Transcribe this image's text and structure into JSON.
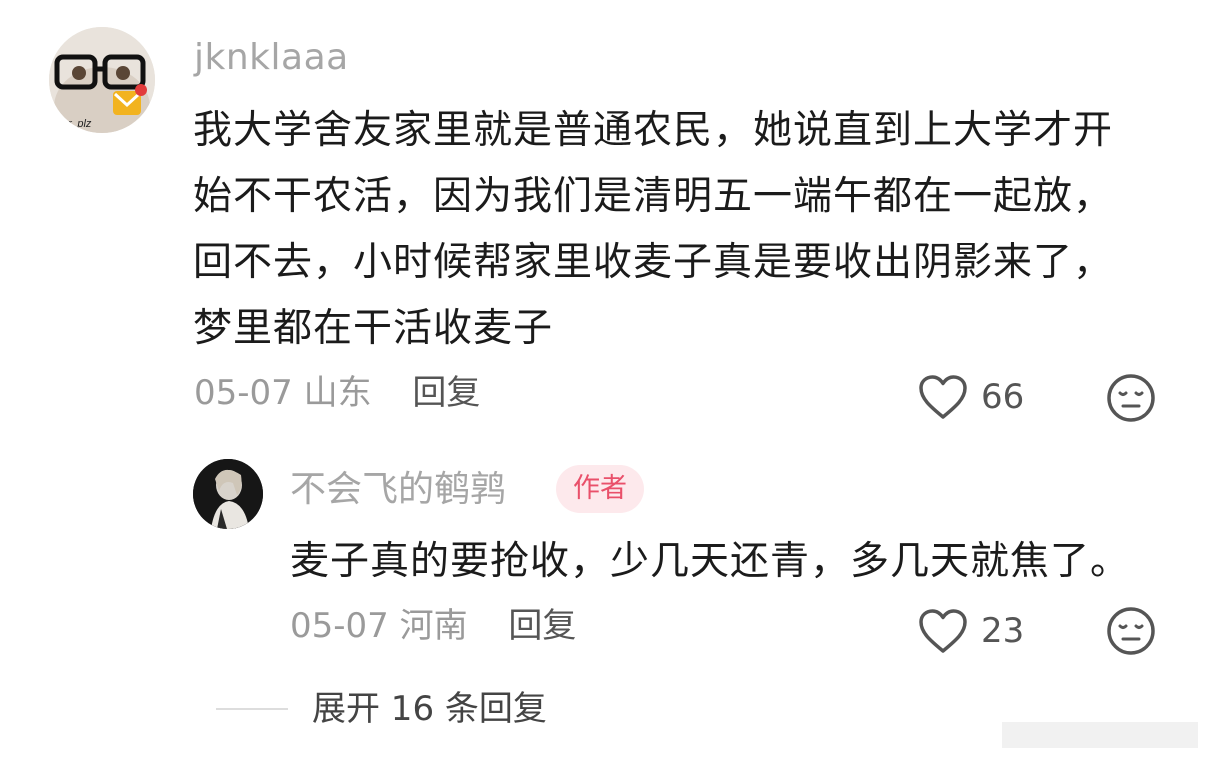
{
  "comment": {
    "username": "jknklaaa",
    "avatar": "glasses-dog-avatar",
    "avatar_caption": "fer, plz",
    "text": "我大学舍友家里就是普通农民，她说直到上大学才开\n始不干农活，因为我们是清明五一端午都在一起放，\n回不去，小时候帮家里收麦子真是要收出阴影来了，\n梦里都在干活收麦子",
    "date": "05-07",
    "location": "山东",
    "reply_label": "回复",
    "likes": "66",
    "like_icon": "heart-outline-icon",
    "reaction_icon": "neutral-face-icon"
  },
  "reply": {
    "username": "不会飞的鹌鹑",
    "avatar": "dark-portrait-avatar",
    "badge": "作者",
    "text": "麦子真的要抢收，少几天还青，多几天就焦了。",
    "date": "05-07",
    "location": "河南",
    "reply_label": "回复",
    "likes": "23",
    "like_icon": "heart-outline-icon",
    "reaction_icon": "neutral-face-icon"
  },
  "expand": {
    "label": "展开 16 条回复"
  },
  "colors": {
    "username": "#a6a6a6",
    "badge_bg": "#fde9ec",
    "badge_text": "#e9506a",
    "meta": "#9a9a9a"
  }
}
